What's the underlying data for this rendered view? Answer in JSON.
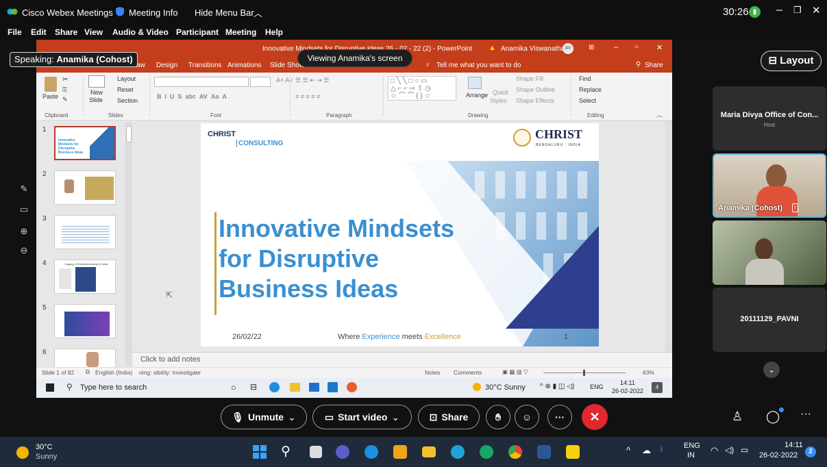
{
  "app": {
    "name": "Cisco Webex Meetings",
    "meeting_info": "Meeting Info",
    "hide_menu": "Hide Menu Bar",
    "timer": "30:26",
    "menu": [
      "File",
      "Edit",
      "Share",
      "View",
      "Audio & Video",
      "Participant",
      "Meeting",
      "Help"
    ]
  },
  "share": {
    "speaking_prefix": "Speaking:",
    "speaking_name": "Anamika (Cohost)",
    "viewing": "Viewing Anamika's screen",
    "layout_label": "Layout"
  },
  "powerpoint": {
    "title": "Innovative Mindsets for Disruptive Ideas 26 - 02 - 22 (2) - PowerPoint",
    "user": "Anamika Viswanathan",
    "user_initials": "AV",
    "tabs": [
      "aw",
      "Design",
      "Transitions",
      "Animations",
      "Slide Show"
    ],
    "tell_me": "Tell me what you want to do",
    "share": "Share",
    "ribbon": {
      "paste": "Paste",
      "new_slide": "New",
      "new_slide_2": "Slide",
      "layout": "Layout",
      "reset": "Reset",
      "section": "Section",
      "arrange": "Arrange",
      "quick": "Quick",
      "styles": "Styles",
      "shape_fill": "Shape Fill",
      "shape_outline": "Shape Outline",
      "shape_effects": "Shape Effects",
      "find": "Find",
      "replace": "Replace",
      "select": "Select",
      "groups": [
        "Clipboard",
        "Slides",
        "Font",
        "Paragraph",
        "Drawing",
        "Editing"
      ]
    },
    "thumbnails": [
      "1",
      "2",
      "3",
      "4",
      "5",
      "6"
    ],
    "thumb1_text": "Innovative Mindsets for Disruptive Business Ideas",
    "thumb4_text": "Legacy of Entrepreneurship in India",
    "slide": {
      "logo_left": "CHRIST",
      "logo_left_sub": "CONSULTING",
      "logo_right": "CHRIST",
      "logo_right_sub": "BENGALURU · INDIA",
      "title_line1": "Innovative Mindsets",
      "title_line2": "for Disruptive",
      "title_line3": "Business Ideas",
      "date": "26/02/22",
      "tag_where": "Where",
      "tag_experience": "Experience",
      "tag_meets": "meets",
      "tag_excellence": "Excellence",
      "page": "1"
    },
    "notes_placeholder": "Click to add notes",
    "status": {
      "slide_count": "Slide 1 of 82",
      "language": "English (India)",
      "accessibility": "ning: sibility: Investigate",
      "notes": "Notes",
      "comments": "Comments",
      "zoom": "63%"
    },
    "win_taskbar": {
      "search": "Type here to search",
      "weather": "30°C Sunny",
      "lang": "ENG",
      "time": "14:11",
      "date": "26-02-2022",
      "notif": "4"
    }
  },
  "participants": [
    {
      "name": "Maria Divya Office of Con...",
      "role": "Host"
    },
    {
      "name": "Anamika (Cohost)"
    },
    {
      "name": ""
    },
    {
      "name": "20111129_PAVNI"
    }
  ],
  "controls": {
    "unmute": "Unmute",
    "start_video": "Start video",
    "share": "Share"
  },
  "taskbar": {
    "temp": "30°C",
    "condition": "Sunny",
    "lang1": "ENG",
    "lang2": "IN",
    "time": "14:11",
    "date": "26-02-2022",
    "badge": "2"
  },
  "colors": {
    "ppt_red": "#c43e1c",
    "slide_blue": "#3a8fd0",
    "slide_gold": "#c8a03c",
    "leave_red": "#e0282f",
    "teal_border": "#4fb7e8"
  }
}
